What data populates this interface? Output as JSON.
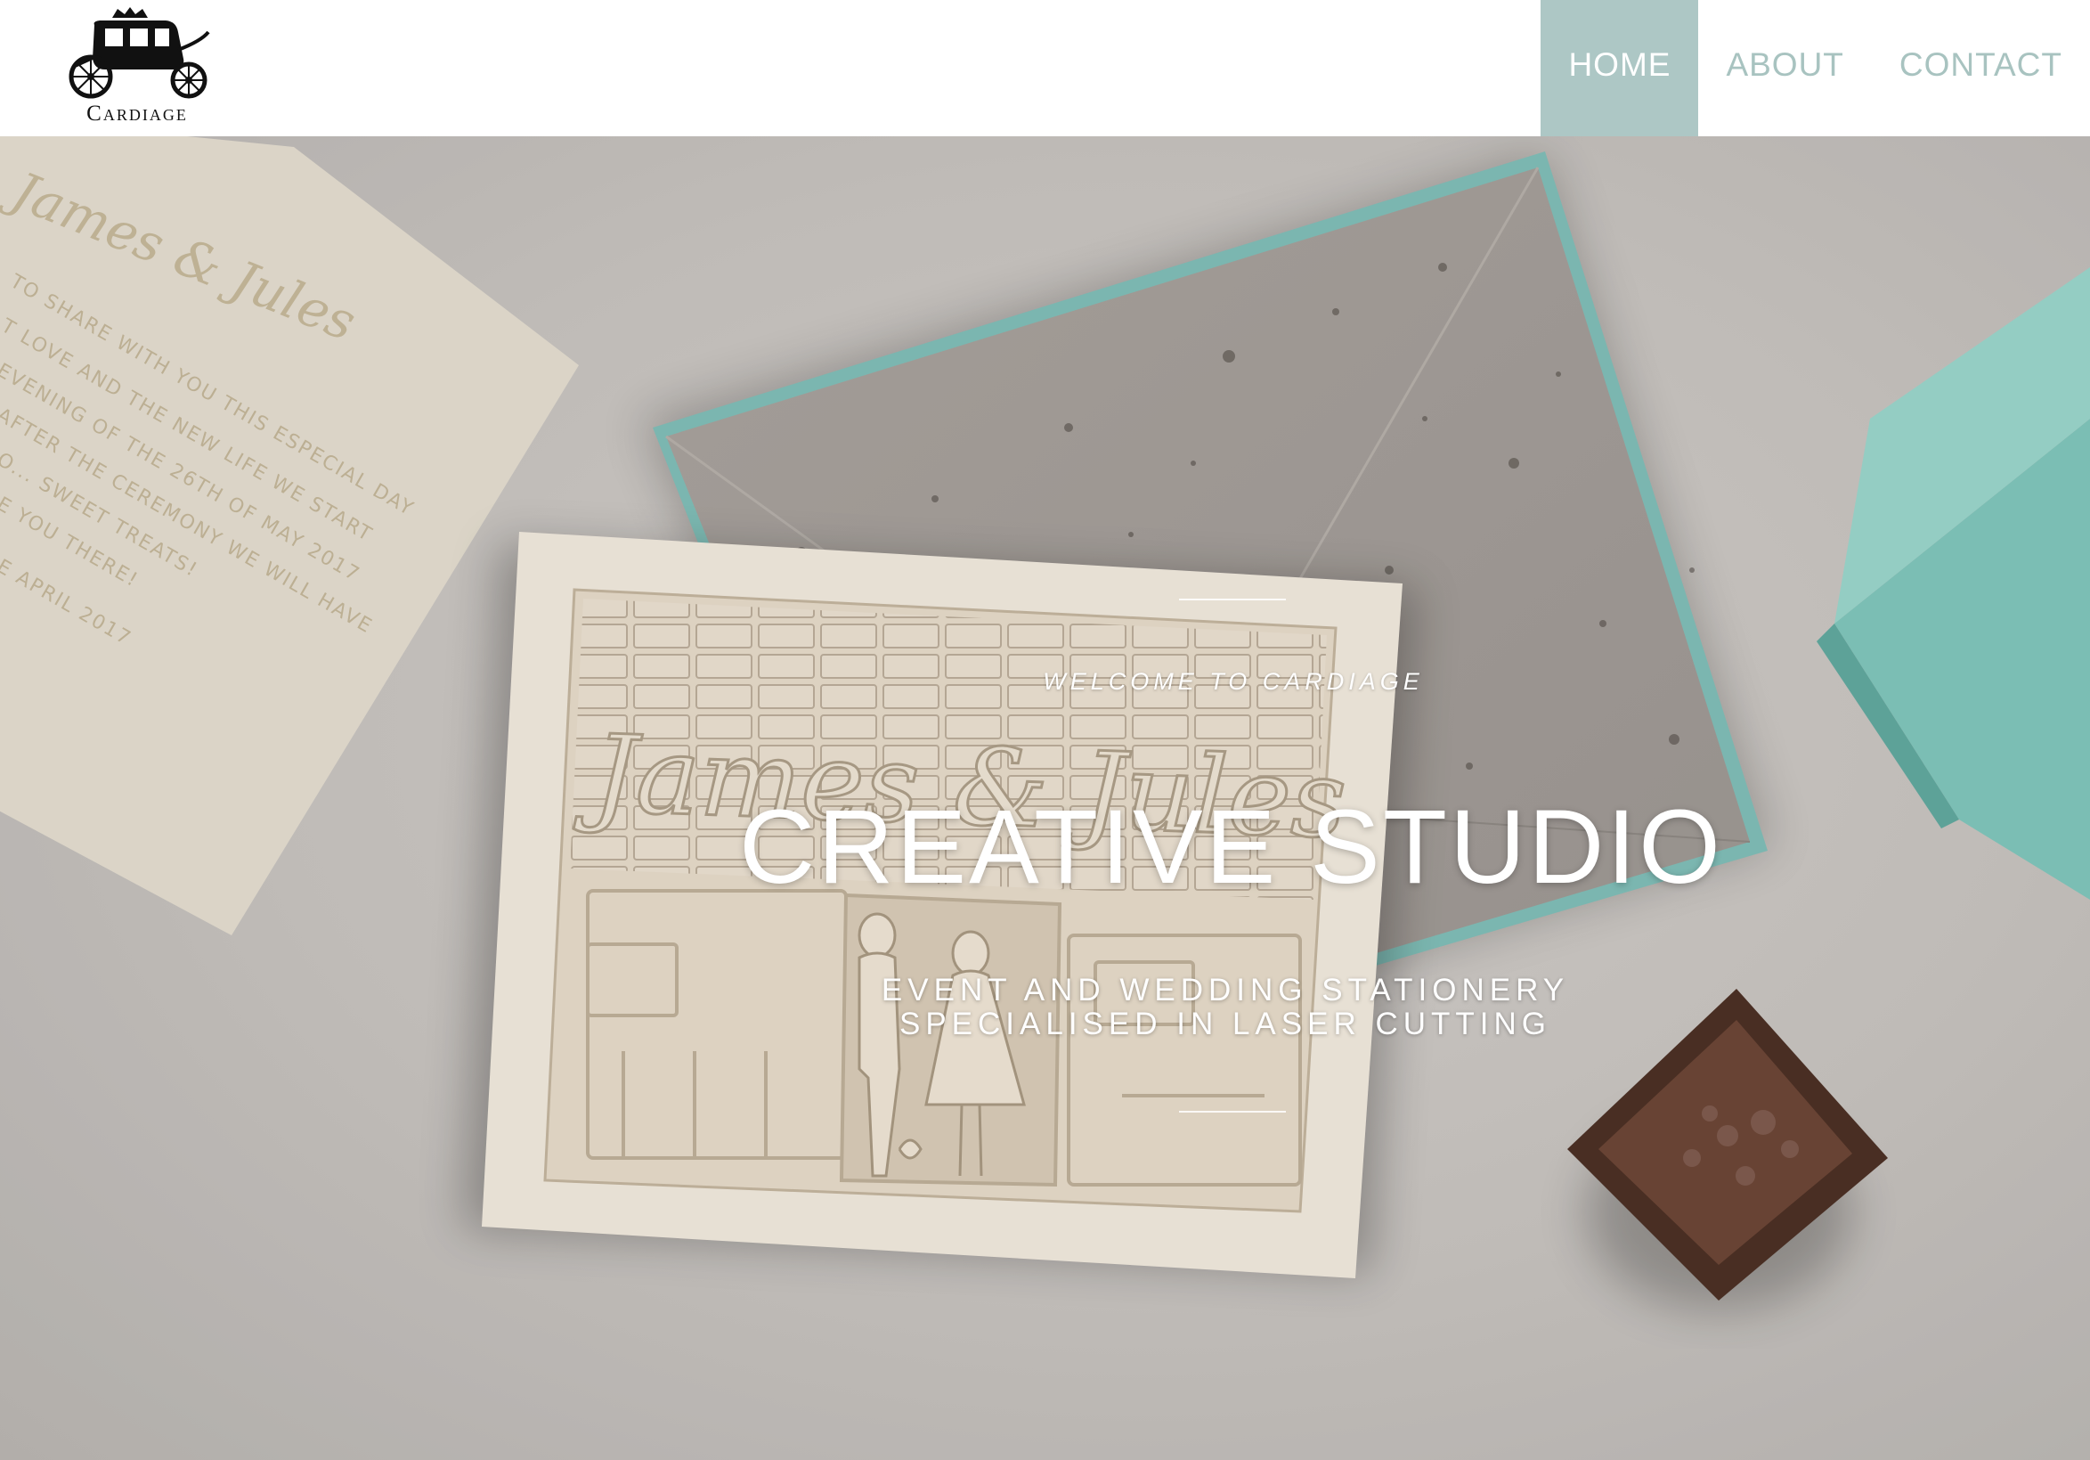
{
  "brand": {
    "name": "Cardiage"
  },
  "nav": {
    "items": [
      {
        "label": "HOME",
        "active": true
      },
      {
        "label": "ABOUT",
        "active": false
      },
      {
        "label": "CONTACT",
        "active": false
      }
    ]
  },
  "hero": {
    "eyebrow": "WELCOME TO CARDIAGE",
    "title": "CREATIVE STUDIO",
    "subtitle_line1": "EVENT AND WEDDING STATIONERY",
    "subtitle_line2": "SPECIALISED IN LASER CUTTING"
  },
  "colors": {
    "accent": "#adc7c5",
    "nav_text": "#a8c3c0",
    "header_bg": "#ffffff"
  }
}
